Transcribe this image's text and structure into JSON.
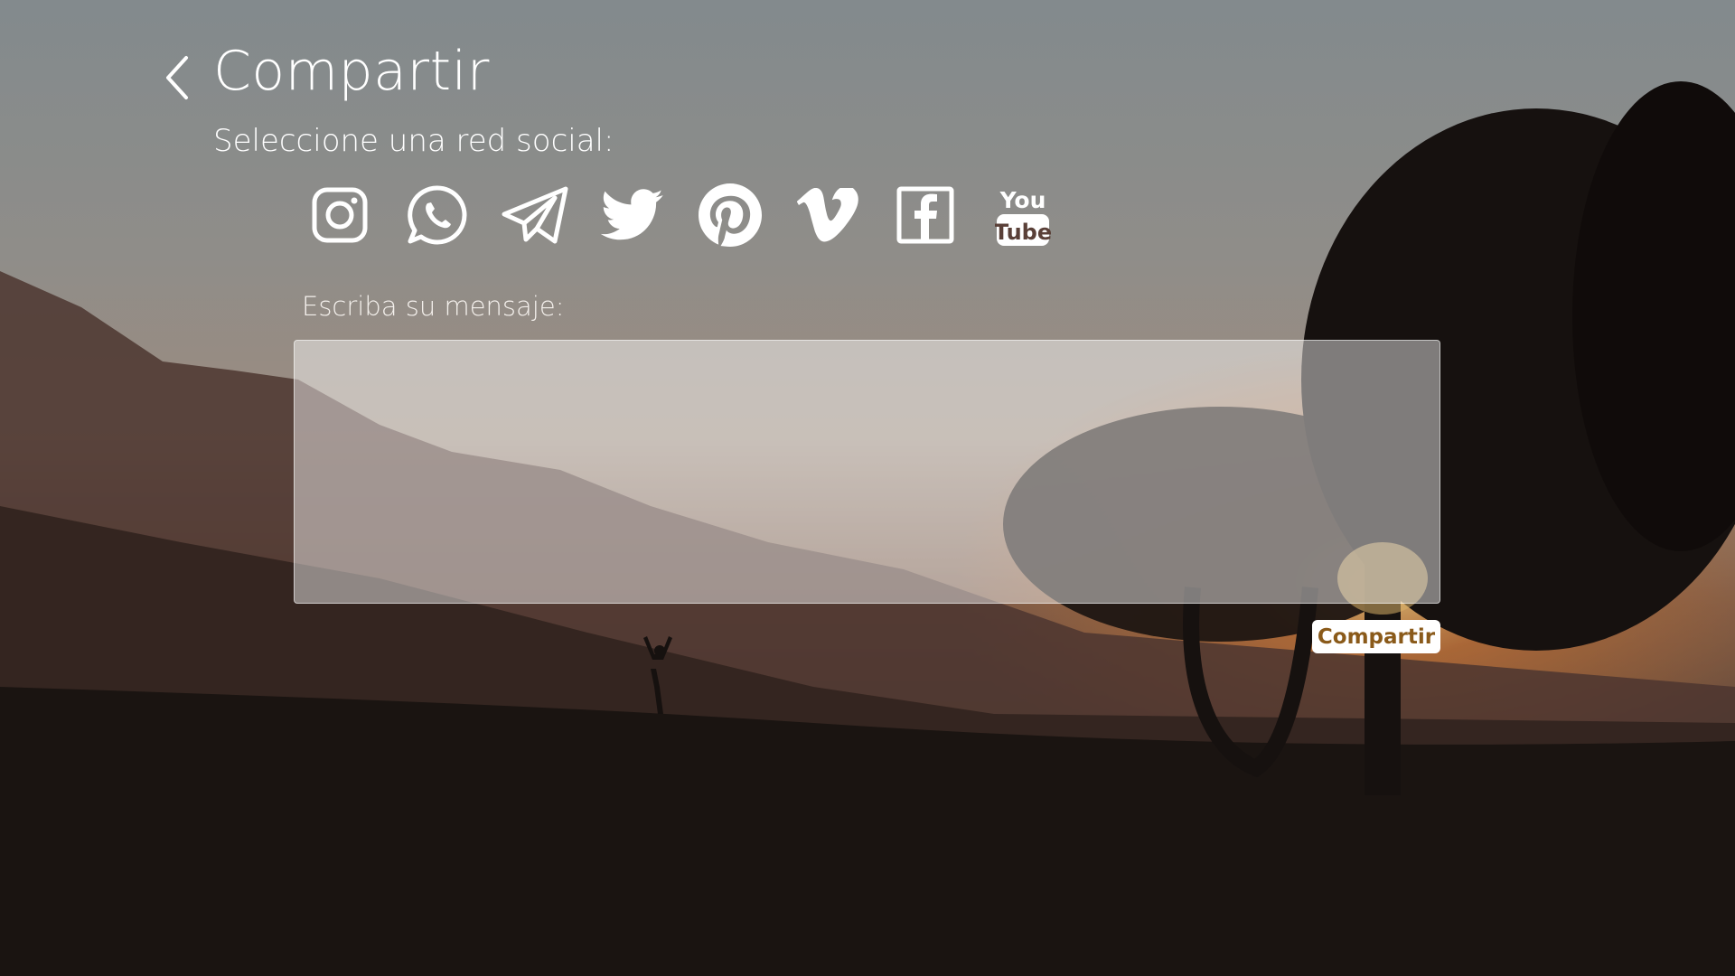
{
  "header": {
    "back_icon": "chevron-left-icon",
    "title": "Compartir"
  },
  "share": {
    "select_label": "Seleccione una red social:",
    "networks": [
      {
        "name": "Instagram",
        "icon": "instagram-icon"
      },
      {
        "name": "WhatsApp",
        "icon": "whatsapp-icon"
      },
      {
        "name": "Telegram",
        "icon": "telegram-icon"
      },
      {
        "name": "Twitter",
        "icon": "twitter-icon"
      },
      {
        "name": "Pinterest",
        "icon": "pinterest-icon"
      },
      {
        "name": "Vimeo",
        "icon": "vimeo-icon"
      },
      {
        "name": "Facebook",
        "icon": "facebook-icon"
      },
      {
        "name": "YouTube",
        "icon": "youtube-icon",
        "text_top": "You",
        "text_bottom": "Tube"
      }
    ]
  },
  "message": {
    "label": "Escriba su mensaje:",
    "value": "",
    "placeholder": ""
  },
  "submit": {
    "label": "Compartir"
  },
  "colors": {
    "icon": "#ffffff",
    "button_text": "#8a5a1a",
    "button_bg": "#ffffff"
  }
}
